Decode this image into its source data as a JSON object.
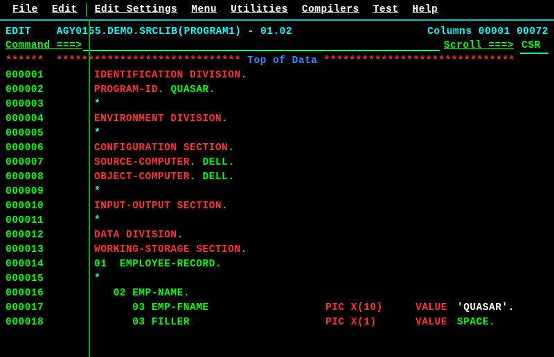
{
  "menu": {
    "file": "File",
    "edit": "Edit",
    "edit_settings": "Edit_Settings",
    "menu": "Menu",
    "utilities": "Utilities",
    "compilers": "Compilers",
    "test": "Test",
    "help": "Help"
  },
  "status": {
    "mode": "EDIT",
    "dataset": "AGY0155.DEMO.SRCLIB(PROGRAM1) - 01.02",
    "columns_label": "Columns",
    "col_start": "00001",
    "col_end": "00072"
  },
  "command": {
    "label": "Command ===>",
    "value": "",
    "scroll_label": "Scroll ===>",
    "scroll_value": "CSR "
  },
  "topdata": {
    "left": "******",
    "stars_l": " ***************************** ",
    "text": "Top of Data",
    "stars_r": " ******************************"
  },
  "code": [
    {
      "n": "000001",
      "t": [
        [
          "red",
          "IDENTIFICATION DIVISION"
        ],
        [
          "green",
          "."
        ]
      ]
    },
    {
      "n": "000002",
      "t": [
        [
          "red",
          "PROGRAM-ID"
        ],
        [
          "green",
          ". "
        ],
        [
          "green",
          "QUASAR"
        ],
        [
          "green",
          "."
        ]
      ]
    },
    {
      "n": "000003",
      "t": [
        [
          "cyan",
          "*"
        ]
      ]
    },
    {
      "n": "000004",
      "t": [
        [
          "red",
          "ENVIRONMENT DIVISION"
        ],
        [
          "green",
          "."
        ]
      ]
    },
    {
      "n": "000005",
      "t": [
        [
          "cyan",
          "*"
        ]
      ]
    },
    {
      "n": "000006",
      "t": [
        [
          "red",
          "CONFIGURATION SECTION"
        ],
        [
          "green",
          "."
        ]
      ]
    },
    {
      "n": "000007",
      "t": [
        [
          "red",
          "SOURCE-COMPUTER"
        ],
        [
          "green",
          ". "
        ],
        [
          "green",
          "DELL"
        ],
        [
          "green",
          "."
        ]
      ]
    },
    {
      "n": "000008",
      "t": [
        [
          "red",
          "OBJECT-COMPUTER"
        ],
        [
          "green",
          ". "
        ],
        [
          "green",
          "DELL"
        ],
        [
          "green",
          "."
        ]
      ]
    },
    {
      "n": "000009",
      "t": [
        [
          "cyan",
          "*"
        ]
      ]
    },
    {
      "n": "000010",
      "t": [
        [
          "red",
          "INPUT-OUTPUT SECTION"
        ],
        [
          "green",
          "."
        ]
      ]
    },
    {
      "n": "000011",
      "t": [
        [
          "cyan",
          "*"
        ]
      ]
    },
    {
      "n": "000012",
      "t": [
        [
          "red",
          "DATA DIVISION"
        ],
        [
          "green",
          "."
        ]
      ]
    },
    {
      "n": "000013",
      "t": [
        [
          "red",
          "WORKING-STORAGE SECTION"
        ],
        [
          "green",
          "."
        ]
      ]
    },
    {
      "n": "000014",
      "t": [
        [
          "green",
          "01  EMPLOYEE-RECORD"
        ],
        [
          "green",
          "."
        ]
      ]
    },
    {
      "n": "000015",
      "t": [
        [
          "cyan",
          "*"
        ]
      ]
    },
    {
      "n": "000016",
      "t": [
        [
          "green",
          "   02 EMP-NAME"
        ],
        [
          "green",
          "."
        ]
      ]
    },
    {
      "n": "000017",
      "t": [
        [
          "green",
          "      03 EMP-FNAME"
        ]
      ],
      "pic": "PIC X(10)",
      "val": "VALUE",
      "lit": "'QUASAR'.",
      "litc": "white"
    },
    {
      "n": "000018",
      "t": [
        [
          "green",
          "      03 FILLER"
        ]
      ],
      "pic": "PIC X(1)",
      "val": "VALUE",
      "lit": "SPACE.",
      "litc": "green"
    }
  ]
}
